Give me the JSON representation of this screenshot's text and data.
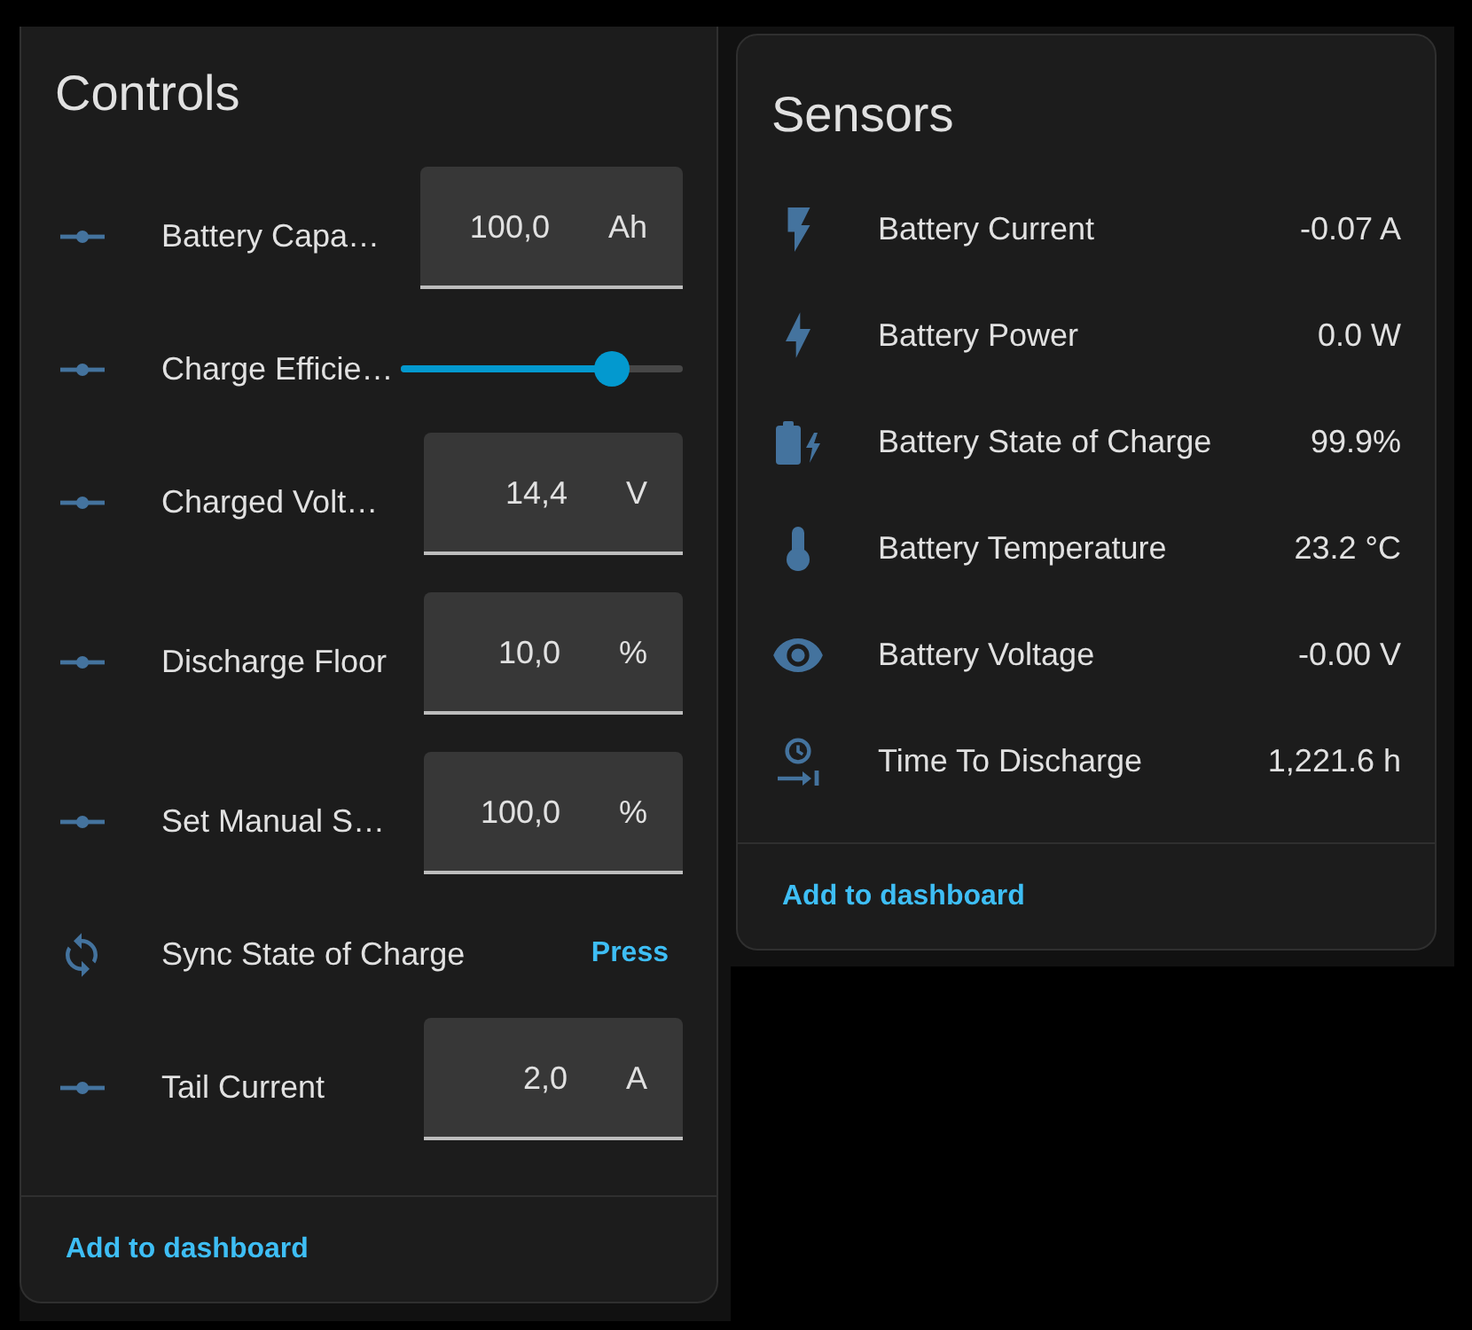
{
  "controls_card": {
    "title": "Controls",
    "rows": [
      {
        "kind": "number",
        "label": "Battery Capa…",
        "value": "100,0",
        "unit": "Ah"
      },
      {
        "kind": "slider",
        "label": "Charge Efficie…",
        "level": 0.75
      },
      {
        "kind": "number",
        "label": "Charged Volt…",
        "value": "14,4",
        "unit": "V"
      },
      {
        "kind": "number",
        "label": "Discharge Floor",
        "value": "10,0",
        "unit": "%"
      },
      {
        "kind": "number",
        "label": "Set Manual S…",
        "value": "100,0",
        "unit": "%"
      },
      {
        "kind": "button",
        "label": "Sync State of Charge",
        "action": "Press"
      },
      {
        "kind": "number",
        "label": "Tail Current",
        "value": "2,0",
        "unit": "A"
      }
    ],
    "footer_action": "Add to dashboard"
  },
  "sensors_card": {
    "title": "Sensors",
    "rows": [
      {
        "kind": "current",
        "label": "Battery Current",
        "value": "-0.07 A"
      },
      {
        "kind": "power",
        "label": "Battery Power",
        "value": "0.0 W"
      },
      {
        "kind": "charge",
        "label": "Battery State of Charge",
        "value": "99.9%"
      },
      {
        "kind": "temperature",
        "label": "Battery Temperature",
        "value": "23.2 °C"
      },
      {
        "kind": "voltage",
        "label": "Battery Voltage",
        "value": "-0.00 V"
      },
      {
        "kind": "duration",
        "label": "Time To Discharge",
        "value": "1,221.6 h"
      }
    ],
    "footer_action": "Add to dashboard"
  }
}
